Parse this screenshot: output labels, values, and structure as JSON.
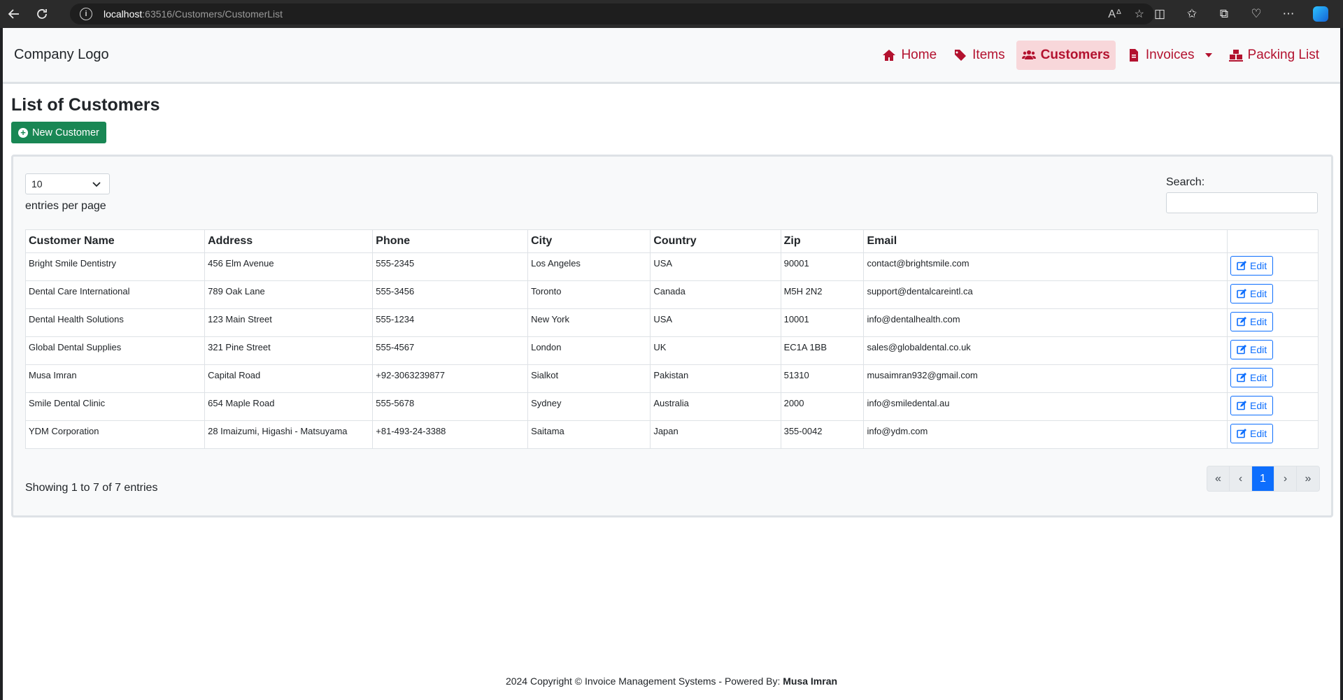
{
  "browser": {
    "url_host": "localhost",
    "url_rest": ":63516/Customers/CustomerList"
  },
  "navbar": {
    "brand": "Company Logo",
    "items": [
      {
        "label": "Home",
        "icon": "home-icon"
      },
      {
        "label": "Items",
        "icon": "tags-icon"
      },
      {
        "label": "Customers",
        "icon": "users-icon",
        "active": true
      },
      {
        "label": "Invoices",
        "icon": "file-invoice-icon",
        "dropdown": true
      },
      {
        "label": "Packing List",
        "icon": "pallet-boxes-icon"
      }
    ]
  },
  "page": {
    "title": "List of Customers",
    "new_button": "New Customer"
  },
  "table_controls": {
    "page_length": "10",
    "length_label": "entries per page",
    "search_label": "Search:",
    "search_value": ""
  },
  "table": {
    "headers": [
      "Customer Name",
      "Address",
      "Phone",
      "City",
      "Country",
      "Zip",
      "Email",
      ""
    ],
    "rows": [
      [
        "Bright Smile Dentistry",
        "456 Elm Avenue",
        "555-2345",
        "Los Angeles",
        "USA",
        "90001",
        "contact@brightsmile.com"
      ],
      [
        "Dental Care International",
        "789 Oak Lane",
        "555-3456",
        "Toronto",
        "Canada",
        "M5H 2N2",
        "support@dentalcareintl.ca"
      ],
      [
        "Dental Health Solutions",
        "123 Main Street",
        "555-1234",
        "New York",
        "USA",
        "10001",
        "info@dentalhealth.com"
      ],
      [
        "Global Dental Supplies",
        "321 Pine Street",
        "555-4567",
        "London",
        "UK",
        "EC1A 1BB",
        "sales@globaldental.co.uk"
      ],
      [
        "Musa Imran",
        "Capital Road",
        "+92-3063239877",
        "Sialkot",
        "Pakistan",
        "51310",
        "musaimran932@gmail.com"
      ],
      [
        "Smile Dental Clinic",
        "654 Maple Road",
        "555-5678",
        "Sydney",
        "Australia",
        "2000",
        "info@smiledental.au"
      ],
      [
        "YDM Corporation",
        "28 Imaizumi, Higashi - Matsuyama",
        "+81-493-24-3388",
        "Saitama",
        "Japan",
        "355-0042",
        "info@ydm.com"
      ]
    ],
    "edit_label": "Edit"
  },
  "footer_table": {
    "info": "Showing 1 to 7 of 7 entries",
    "pager": [
      "«",
      "‹",
      "1",
      "›",
      "»"
    ],
    "current_page": "1"
  },
  "footer": {
    "text": "2024 Copyright © Invoice Management Systems - Powered By: ",
    "author": "Musa Imran"
  },
  "colors": {
    "nav_accent": "#b3122f",
    "active_bg": "#f8d7da",
    "primary": "#0d6efd",
    "success": "#198754"
  }
}
